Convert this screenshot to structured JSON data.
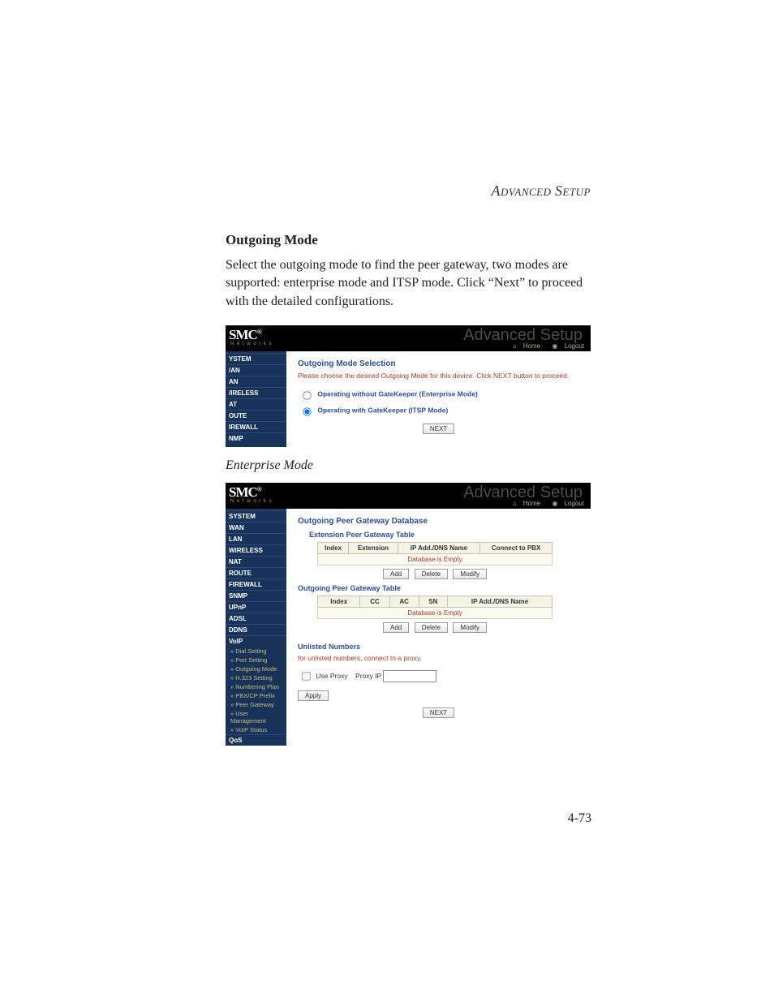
{
  "page_header": "Advanced Setup",
  "section_title": "Outgoing Mode",
  "body_text": "Select the outgoing mode to find the peer gateway, two modes are supported: enterprise mode and ITSP mode. Click “Next” to proceed with the detailed configurations.",
  "subsection_title": "Enterprise Mode",
  "page_number": "4-73",
  "logo": {
    "brand": "SMC",
    "reg": "®",
    "sub": "N e t w o r k s"
  },
  "ghost_title": "Advanced Setup",
  "head_links": {
    "home": "Home",
    "logout": "Logout"
  },
  "shot1": {
    "sidebar": [
      "YSTEM",
      "/AN",
      "AN",
      "/IRELESS",
      "AT",
      "OUTE",
      "IREWALL",
      "NMP"
    ],
    "title": "Outgoing Mode Selection",
    "desc": "Please choose the desired Outgoing Mode for this device. Click NEXT button to proceed.",
    "opt1": "Operating without GateKeeper (Enterprise Mode)",
    "opt2": "Operating with GateKeeper (ITSP Mode)",
    "next_btn": "NEXT"
  },
  "shot2": {
    "sidebar_main": [
      "SYSTEM",
      "WAN",
      "LAN",
      "WIRELESS",
      "NAT",
      "ROUTE",
      "FIREWALL",
      "SNMP",
      "UPnP",
      "ADSL",
      "DDNS",
      "VoIP"
    ],
    "sidebar_sub": [
      "» Dial Setting",
      "» Port Setting",
      "» Outgoing Mode",
      "» H.323 Setting",
      "» Numbering Plan",
      "» PBX/CP Prefix",
      "» Peer Gateway",
      "» User Management",
      "» VoIP Status"
    ],
    "sidebar_tail": [
      "QoS"
    ],
    "title": "Outgoing Peer Gateway Database",
    "table1_title": "Extension Peer Gateway Table",
    "table1_headers": [
      "Index",
      "Extension",
      "IP Add./DNS Name",
      "Connect to PBX"
    ],
    "empty_msg": "Database is Empty",
    "btn_add": "Add",
    "btn_delete": "Delete",
    "btn_modify": "Modify",
    "table2_title": "Outgoing Peer Gateway Table",
    "table2_headers": [
      "Index",
      "CC",
      "AC",
      "SN",
      "IP Add./DNS Name"
    ],
    "unlisted_title": "Unlisted Numbers",
    "unlisted_desc": "for unlisted numbers, connect to a proxy.",
    "use_proxy_label": "Use Proxy",
    "proxy_ip_label": "Proxy IP",
    "apply_btn": "Apply",
    "next_btn": "NEXT"
  }
}
